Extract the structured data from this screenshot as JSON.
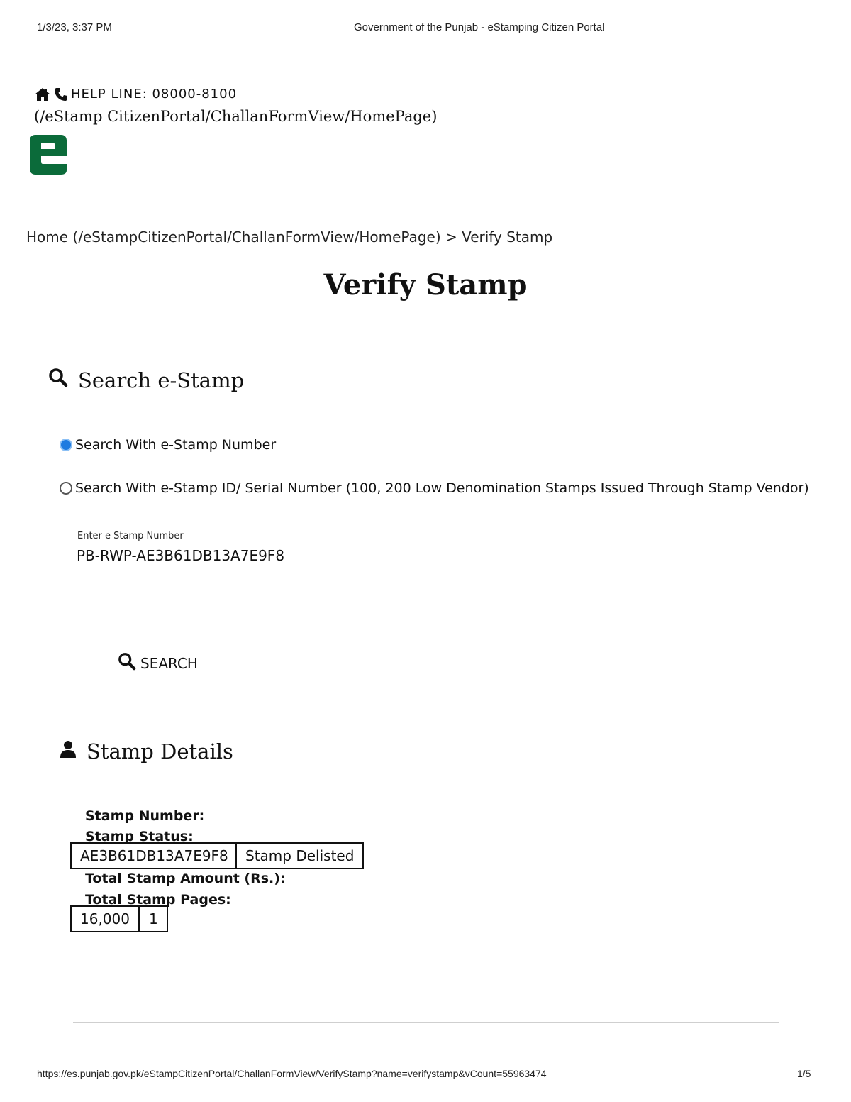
{
  "print_header": {
    "datetime": "1/3/23, 3:37 PM",
    "page_title": "Government of the Punjab - eStamping Citizen Portal"
  },
  "topbar": {
    "helpline": "HELP LINE: 08000-8100",
    "home_path": "(/eStamp CitizenPortal/ChallanFormView/HomePage)"
  },
  "logo": {
    "letter": "e",
    "color": "#0b6b3a"
  },
  "breadcrumb": {
    "home": "Home (/eStampCitizenPortal/ChallanFormView/HomePage)",
    "separator": ">",
    "current": "Verify Stamp"
  },
  "page_heading": "Verify Stamp",
  "search_section": {
    "title": "Search e-Stamp",
    "options": [
      {
        "label": "Search With e-Stamp Number",
        "selected": true
      },
      {
        "label": "Search With e-Stamp ID/ Serial Number (100, 200 Low Denomination Stamps Issued Through Stamp Vendor)",
        "selected": false
      }
    ],
    "input_label": "Enter e Stamp Number",
    "input_value": "PB-RWP-AE3B61DB13A7E9F8",
    "button_label": "SEARCH"
  },
  "details_section": {
    "title": "Stamp Details",
    "stamp_number_label": "Stamp Number:",
    "stamp_status_label": "Stamp Status:",
    "stamp_number_value": "AE3B61DB13A7E9F8",
    "stamp_status_value": "Stamp Delisted",
    "total_amount_label": "Total Stamp Amount (Rs.):",
    "total_pages_label": "Total Stamp Pages:",
    "total_amount_value": "16,000",
    "total_pages_value": "1"
  },
  "print_footer": {
    "url": "https://es.punjab.gov.pk/eStampCitizenPortal/ChallanFormView/VerifyStamp?name=verifystamp&vCount=55963474",
    "page_number": "1/5"
  }
}
